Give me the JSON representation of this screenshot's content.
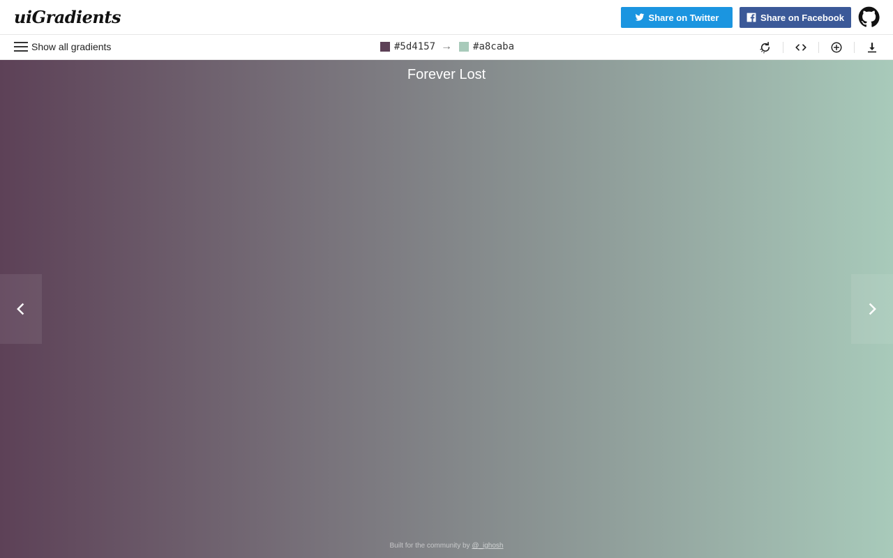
{
  "header": {
    "logo": "uiGradients",
    "twitter_label": "Share on Twitter",
    "facebook_label": "Share on Facebook"
  },
  "toolbar": {
    "menu_label": "Show all gradients",
    "color_from": "#5d4157",
    "color_to": "#a8caba",
    "arrow": "→"
  },
  "gradient": {
    "name": "Forever Lost",
    "start": "#5d4157",
    "end": "#a8caba"
  },
  "footer": {
    "text": "Built for the community by ",
    "link": "@_ighosh"
  },
  "icons": [
    "twitter-icon",
    "facebook-icon",
    "github-icon",
    "menu-icon",
    "rotate-icon",
    "code-icon",
    "add-icon",
    "download-icon",
    "chevron-left-icon",
    "chevron-right-icon"
  ]
}
